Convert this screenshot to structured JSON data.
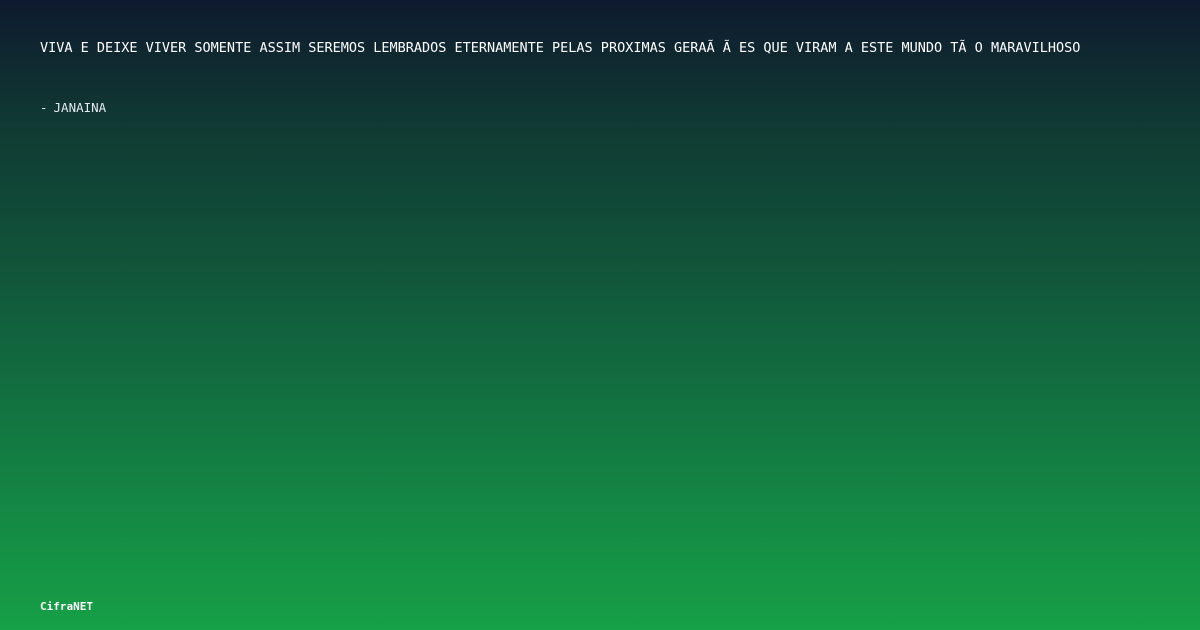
{
  "quote": {
    "text": "VIVA E DEIXE VIVER SOMENTE ASSIM SEREMOS LEMBRADOS ETERNAMENTE PELAS PROXIMAS GERAÃ Ã ES QUE VIRAM A ESTE MUNDO TÃ O MARAVILHOSO",
    "author_prefix": "-",
    "author": "JANAINA"
  },
  "brand": {
    "name": "CifraNET"
  },
  "colors": {
    "background_top": "#0e1a2e",
    "background_bottom": "#16a047",
    "text": "#ffffff"
  }
}
